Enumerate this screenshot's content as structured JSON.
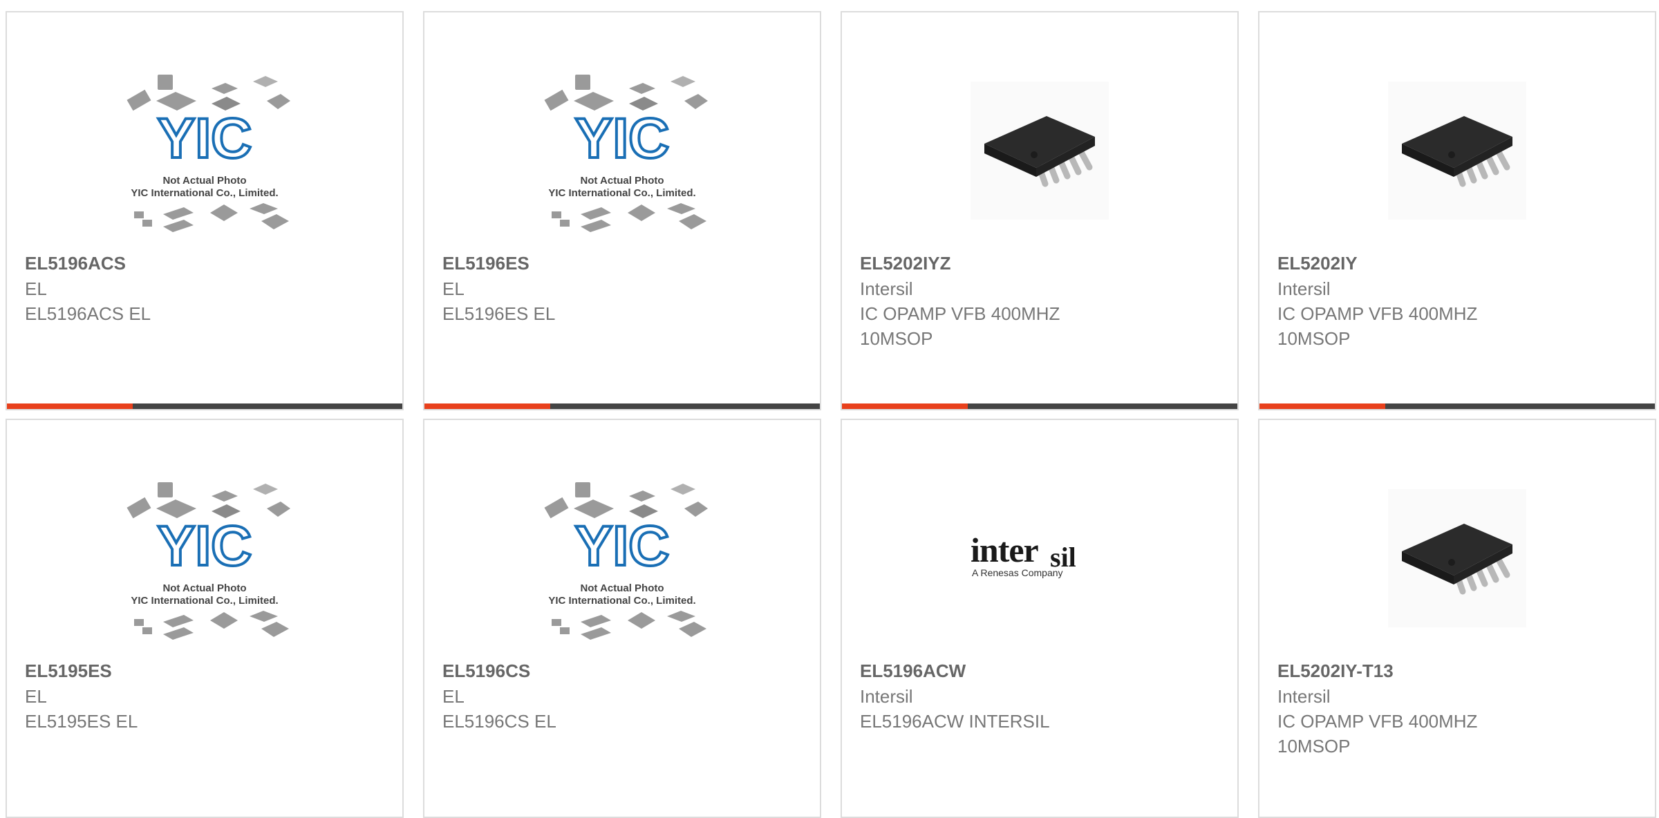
{
  "colors": {
    "accent": "#e8401c",
    "bar": "#444444",
    "text": "#707070",
    "yic_blue": "#1a6fb5"
  },
  "placeholder": {
    "line1": "Not Actual Photo",
    "line2": "YIC International Co., Limited."
  },
  "products": [
    {
      "part": "EL5196ACS",
      "mfr": "EL",
      "desc": "EL5196ACS EL",
      "image": "yic-placeholder"
    },
    {
      "part": "EL5196ES",
      "mfr": "EL",
      "desc": "EL5196ES EL",
      "image": "yic-placeholder"
    },
    {
      "part": "EL5202IYZ",
      "mfr": "Intersil",
      "desc": "IC OPAMP VFB 400MHZ 10MSOP",
      "image": "msop-chip"
    },
    {
      "part": "EL5202IY",
      "mfr": "Intersil",
      "desc": "IC OPAMP VFB 400MHZ 10MSOP",
      "image": "msop-chip"
    },
    {
      "part": "EL5195ES",
      "mfr": "EL",
      "desc": "EL5195ES EL",
      "image": "yic-placeholder"
    },
    {
      "part": "EL5196CS",
      "mfr": "EL",
      "desc": "EL5196CS EL",
      "image": "yic-placeholder"
    },
    {
      "part": "EL5196ACW",
      "mfr": "Intersil",
      "desc": "EL5196ACW INTERSIL",
      "image": "intersil-logo"
    },
    {
      "part": "EL5202IY-T13",
      "mfr": "Intersil",
      "desc": "IC OPAMP VFB 400MHZ 10MSOP",
      "image": "msop-chip"
    }
  ],
  "intersil_logo": {
    "word": "intersil",
    "tagline": "A Renesas Company"
  }
}
